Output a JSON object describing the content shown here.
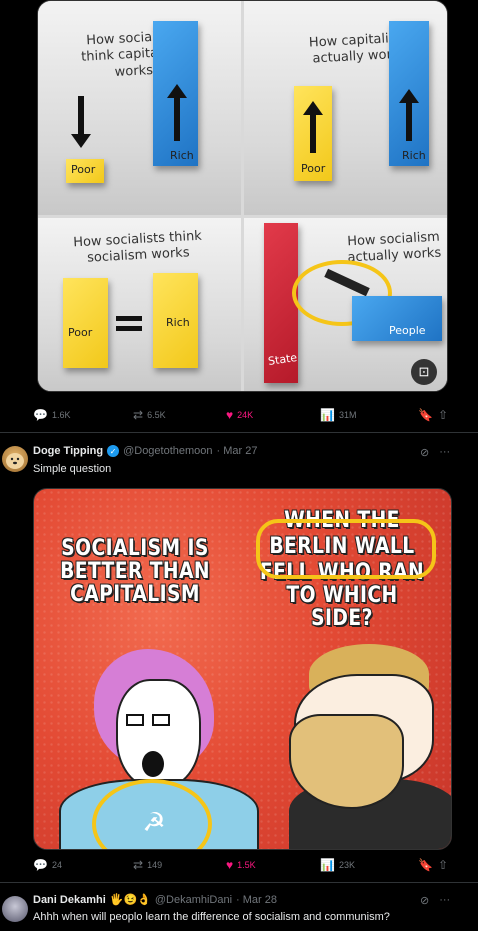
{
  "tweet1": {
    "panels": [
      {
        "caption": "How socialists think capitalism works",
        "labels": [
          "Poor",
          "Rich"
        ]
      },
      {
        "caption": "How capitalism actually works",
        "labels": [
          "Poor",
          "Rich"
        ]
      },
      {
        "caption": "How socialists think socialism works",
        "labels": [
          "Poor",
          "Rich"
        ]
      },
      {
        "caption": "How socialism actually works",
        "labels": [
          "State",
          "People"
        ]
      }
    ],
    "actions": {
      "replies": "1.6K",
      "retweets": "6.5K",
      "likes": "24K",
      "views": "31M"
    }
  },
  "tweet2": {
    "name": "Doge Tipping",
    "handle": "@Dogetothemoon",
    "date": "· Mar 27",
    "text": "Simple question",
    "meme_left": "SOCIALISM IS BETTER THAN CAPITALISM",
    "meme_right_top": "WHEN THE",
    "meme_right_mid": "BERLIN WALL",
    "meme_right_bottom": "FELL WHO RAN TO WHICH SIDE?",
    "actions": {
      "replies": "24",
      "retweets": "149",
      "likes": "1.5K",
      "views": "23K"
    }
  },
  "tweet3": {
    "name": "Dani Dekamhi",
    "emojis": "🖐😉👌",
    "handle": "@DekamhiDani",
    "date": "· Mar 28",
    "text": "Ahhh when will peoplo learn the difference of socialism and communism?"
  },
  "icons": {
    "reply": "💬",
    "retweet": "⇄",
    "like": "♥",
    "views": "📊",
    "bookmark": "🔖",
    "share": "⇧",
    "grok": "⊘",
    "more": "···"
  },
  "colors": {
    "like": "#f91880",
    "accent": "#1d9bf0",
    "highlight": "#f5c518"
  }
}
